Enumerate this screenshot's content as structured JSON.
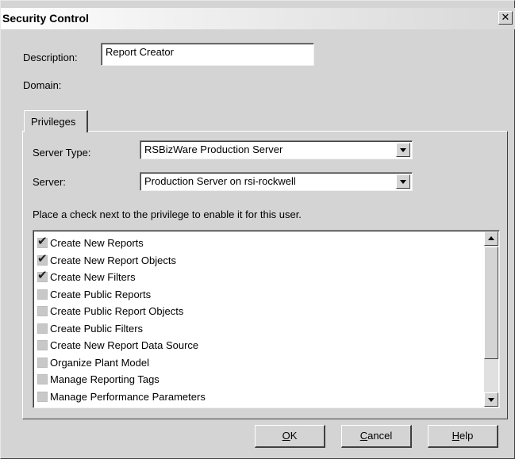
{
  "window": {
    "title": "Security Control",
    "close_glyph": "✕"
  },
  "form": {
    "description_label": "Description:",
    "description_value": "Report Creator",
    "domain_label": "Domain:"
  },
  "tabs": [
    {
      "label": "Privileges",
      "selected": true
    }
  ],
  "privileges": {
    "server_type_label": "Server Type:",
    "server_type_value": "RSBizWare Production Server",
    "server_label": "Server:",
    "server_value": "Production Server on rsi-rockwell",
    "instruction": "Place a check next to the privilege to enable it for this user.",
    "items": [
      {
        "label": "Create New Reports",
        "checked": true
      },
      {
        "label": "Create New Report Objects",
        "checked": true
      },
      {
        "label": "Create New Filters",
        "checked": true
      },
      {
        "label": "Create Public Reports",
        "checked": false
      },
      {
        "label": "Create Public Report Objects",
        "checked": false
      },
      {
        "label": "Create Public Filters",
        "checked": false
      },
      {
        "label": "Create New Report Data Source",
        "checked": false
      },
      {
        "label": "Organize Plant Model",
        "checked": false
      },
      {
        "label": "Manage Reporting Tags",
        "checked": false
      },
      {
        "label": "Manage Performance Parameters",
        "checked": false
      }
    ]
  },
  "buttons": {
    "ok": {
      "prefix": "",
      "accel": "O",
      "rest": "K"
    },
    "cancel": {
      "prefix": "",
      "accel": "C",
      "rest": "ancel"
    },
    "help": {
      "prefix": "",
      "accel": "H",
      "rest": "elp"
    }
  },
  "icons": {
    "checkmark": "checkmark-icon",
    "dropdown": "chevron-down-icon",
    "scroll_up": "scroll-up-icon",
    "scroll_down": "scroll-down-icon",
    "close": "close-icon"
  }
}
